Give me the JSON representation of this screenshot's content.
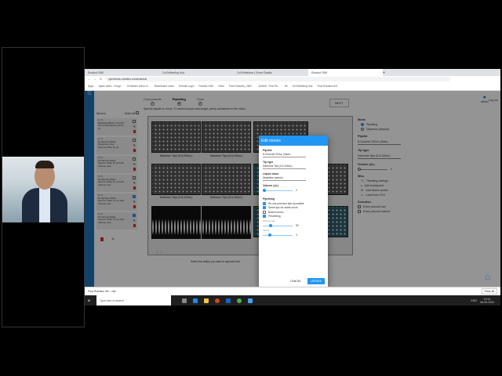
{
  "browser": {
    "tabs": [
      "Rowbot ONE",
      "GoToMeeting Hub",
      "GoToWebinar | Event Details",
      "Rowbot ONE"
    ],
    "url": "opentrons-robotics.com/manual",
    "bookmarks": [
      "Apps",
      "Japan sales - Googl...",
      "Exhibition sheet of...",
      "Blackboard Learn",
      "Hotmail Login",
      "Rowbot ONE",
      "Odoo",
      "Flow Robotics_VidR...",
      "114808 - Flow Ro...",
      "vik",
      "GoToMeeting Hub",
      "Flow Robotics A/S"
    ]
  },
  "app": {
    "steps": [
      {
        "label": "Components",
        "n": "1"
      },
      {
        "label": "Pipetting",
        "n": "2"
      },
      {
        "label": "Save",
        "n": "3"
      }
    ],
    "next": "NEXT",
    "user": "admin",
    "logout": "Log out",
    "instructions": "Specify liquids to move. To select source and target, press containers in the video.",
    "moves_title": "Moves",
    "select_all": "Select all",
    "moves": [
      {
        "lines": [
          "1 / 6",
          "BioShake3000-T (incl 96",
          "Port temperature control",
          "on"
        ],
        "checked": false
      },
      {
        "lines": [
          "2 / 6",
          "8-Channel 200uL",
          "Dispense move",
          "Source: Plate IV, A1"
        ],
        "checked": false
      },
      {
        "lines": [
          "3 / 6",
          "8-Channel 200uL",
          "Source: Plate III, A1-H12",
          "Volume: 2uL"
        ],
        "checked": false
      },
      {
        "lines": [
          "4 / 6",
          "8-Channel 200uL",
          "Source: Plate III, A1-H12",
          "Volume: 2uL"
        ],
        "checked": false
      },
      {
        "lines": [
          "5 / 6",
          "8-Channel 200uL",
          "Source: Plate VI, A1-H12",
          "Volume: 2uL"
        ],
        "checked": true
      },
      {
        "lines": [
          "6 / 6",
          "8-Channel 200uL",
          "Source: Plate VI, A1-H12",
          "Volume: 2uL"
        ],
        "checked": true
      }
    ],
    "plates": [
      "Sartorius Tips (0.5-200uL)",
      "Sartorius Tips (0.5-200uL)",
      "Sartorius Tips (0.5-200uL)",
      "Sartorius Tips (0.5-200uL)"
    ],
    "well_hint": "Select the well(s) you want to aspirate from"
  },
  "right": {
    "mode_h": "Mode",
    "modes": [
      "Pipetting",
      "Dispense (aliquot)"
    ],
    "pipette_h": "Pipette",
    "pipette": "8-Channel 200uL (Sarto...",
    "tip_h": "Tip type",
    "tip": "Sartorius Tips (0.5-200uL)",
    "vol_h": "Volume (uL)",
    "vol": "0",
    "misc_h": "Misc",
    "misc": [
      "Pipetting settings",
      "Add breakpoint",
      "Add device action",
      "Load from CSV"
    ],
    "sel_h": "Selection",
    "sel": [
      "Every second row",
      "Every second column"
    ]
  },
  "dialog": {
    "title": "Edit moves",
    "pipette_l": "Pipette",
    "pipette": "8-Channel 200uL (Sarto...",
    "tip_l": "Tip type",
    "tip": "Sartorius Tips (0.5-200uL)",
    "liquid_l": "Liquid class",
    "liquid": "Waterlike (admin)",
    "volume_l": "Volume (uL)",
    "volume": "2",
    "pip_h": "Pipetting",
    "checks": [
      {
        "label": "Re-use previous tips if possible",
        "on": true
      },
      {
        "label": "Same tips for entire move",
        "on": true
      },
      {
        "label": "Bottom touch",
        "on": false
      },
      {
        "label": "Prewetting",
        "on": true
      }
    ],
    "pw_vol_l": "Volume (uL)",
    "pw_vol": "50",
    "pw_times_l": "Times",
    "pw_times": "3",
    "cancel": "CANCEL",
    "update": "UPDATE"
  },
  "downloads": {
    "file": "Flow Robotics Virt....xlsx",
    "show_all": "Show all"
  },
  "taskbar": {
    "search": "Type here to search",
    "time": "10:14",
    "date": "08-09-2020",
    "lang": "ENG"
  }
}
